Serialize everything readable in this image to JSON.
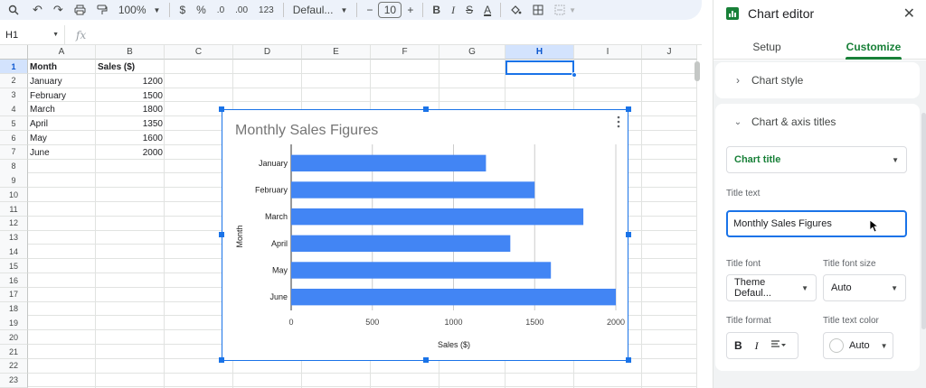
{
  "toolbar": {
    "zoom": "100%",
    "currency": "$",
    "percent": "%",
    "dec_decrease": ".0",
    "dec_increase": ".00",
    "num_format": "123",
    "font": "Defaul...",
    "font_size": "10",
    "minus": "−",
    "plus": "+",
    "bold": "B",
    "italic": "I",
    "strike": "S",
    "text_color": "A"
  },
  "formula_bar": {
    "cell_ref": "H1",
    "fx": "fx"
  },
  "columns": [
    "A",
    "B",
    "C",
    "D",
    "E",
    "F",
    "G",
    "H",
    "I",
    "J"
  ],
  "selected_column": "H",
  "rows": [
    "1",
    "2",
    "3",
    "4",
    "5",
    "6",
    "7",
    "8",
    "9",
    "10",
    "11",
    "12",
    "13",
    "14",
    "15",
    "16",
    "17",
    "18",
    "19",
    "20",
    "21",
    "22",
    "23"
  ],
  "sheet": {
    "headers": {
      "a": "Month",
      "b": "Sales ($)"
    },
    "data": [
      {
        "month": "January",
        "sales": "1200"
      },
      {
        "month": "February",
        "sales": "1500"
      },
      {
        "month": "March",
        "sales": "1800"
      },
      {
        "month": "April",
        "sales": "1350"
      },
      {
        "month": "May",
        "sales": "1600"
      },
      {
        "month": "June",
        "sales": "2000"
      }
    ]
  },
  "chart_data": {
    "type": "bar",
    "orientation": "horizontal",
    "title": "Monthly Sales Figures",
    "xlabel": "Sales ($)",
    "ylabel": "Month",
    "categories": [
      "January",
      "February",
      "March",
      "April",
      "May",
      "June"
    ],
    "values": [
      1200,
      1500,
      1800,
      1350,
      1600,
      2000
    ],
    "xlim": [
      0,
      2000
    ],
    "xticks": [
      "0",
      "500",
      "1000",
      "1500",
      "2000"
    ],
    "grid": true,
    "bar_color": "#4285f4"
  },
  "panel": {
    "title": "Chart editor",
    "tabs": {
      "setup": "Setup",
      "customize": "Customize"
    },
    "chart_style": "Chart style",
    "titles_section": "Chart & axis titles",
    "title_type": "Chart title",
    "title_text_label": "Title text",
    "title_text_value": "Monthly Sales Figures",
    "title_font_label": "Title font",
    "title_font_value": "Theme Defaul...",
    "title_font_size_label": "Title font size",
    "title_font_size_value": "Auto",
    "title_format_label": "Title format",
    "format_bold": "B",
    "format_italic": "I",
    "title_color_label": "Title text color",
    "title_color_value": "Auto"
  },
  "colors": {
    "accent": "#1a73e8",
    "green": "#188038",
    "bar": "#4285f4"
  }
}
